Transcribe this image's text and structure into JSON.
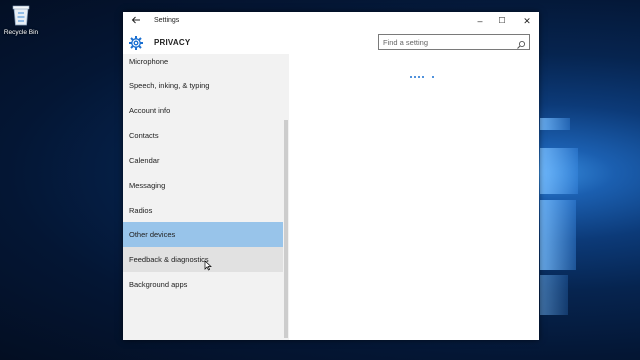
{
  "desktop": {
    "recycle_bin_label": "Recycle Bin"
  },
  "window": {
    "title": "Settings",
    "back_icon": "arrow-left-icon",
    "minimize_glyph": "–",
    "maximize_glyph": "☐",
    "close_glyph": "✕"
  },
  "header": {
    "icon": "gear-icon",
    "heading": "PRIVACY",
    "search_placeholder": "Find a setting"
  },
  "sidebar": {
    "items": [
      {
        "label": "Microphone",
        "state": "normal"
      },
      {
        "label": "Speech, inking, & typing",
        "state": "normal"
      },
      {
        "label": "Account info",
        "state": "normal"
      },
      {
        "label": "Contacts",
        "state": "normal"
      },
      {
        "label": "Calendar",
        "state": "normal"
      },
      {
        "label": "Messaging",
        "state": "normal"
      },
      {
        "label": "Radios",
        "state": "normal"
      },
      {
        "label": "Other devices",
        "state": "selected"
      },
      {
        "label": "Feedback & diagnostics",
        "state": "hover"
      },
      {
        "label": "Background apps",
        "state": "normal"
      }
    ]
  },
  "content": {
    "loading_indicator": "loading-dots"
  },
  "colors": {
    "accent": "#1a6fd1",
    "selected_bg": "#98c4ea",
    "hover_bg": "#e1e1e1",
    "sidebar_bg": "#f2f2f2"
  }
}
